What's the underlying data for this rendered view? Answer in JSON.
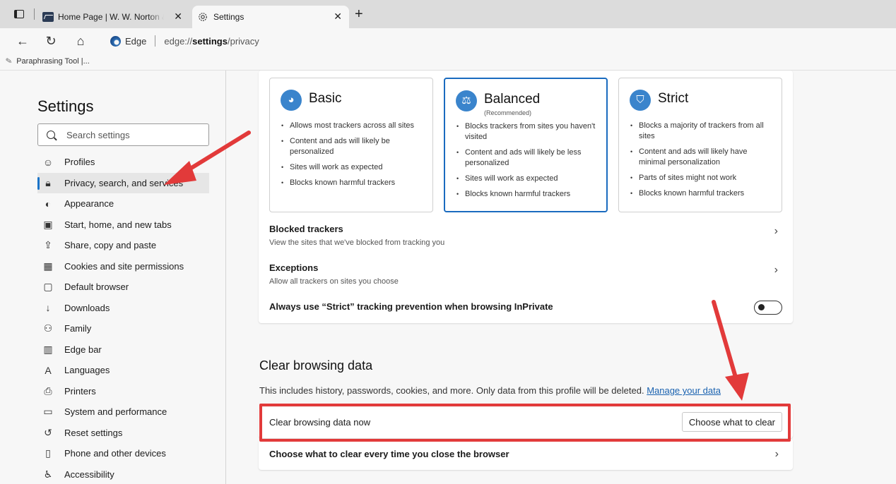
{
  "tabs": [
    {
      "title": "Home Page | W. W. Norton & Co",
      "active": false
    },
    {
      "title": "Settings",
      "active": true
    }
  ],
  "toolbar": {
    "address_label": "Edge",
    "address_url_prefix": "edge://",
    "address_url_host": "settings",
    "address_url_path": "/privacy"
  },
  "favorites": [
    {
      "label": "Paraphrasing Tool |..."
    }
  ],
  "sidebar": {
    "title": "Settings",
    "search_placeholder": "Search settings",
    "items": [
      {
        "label": "Profiles",
        "icon": "profile-icon",
        "active": false
      },
      {
        "label": "Privacy, search, and services",
        "icon": "lock-icon",
        "active": true
      },
      {
        "label": "Appearance",
        "icon": "palette-icon",
        "active": false
      },
      {
        "label": "Start, home, and new tabs",
        "icon": "home-tabs-icon",
        "active": false
      },
      {
        "label": "Share, copy and paste",
        "icon": "share-icon",
        "active": false
      },
      {
        "label": "Cookies and site permissions",
        "icon": "cookies-icon",
        "active": false
      },
      {
        "label": "Default browser",
        "icon": "browser-icon",
        "active": false
      },
      {
        "label": "Downloads",
        "icon": "download-icon",
        "active": false
      },
      {
        "label": "Family",
        "icon": "family-icon",
        "active": false
      },
      {
        "label": "Edge bar",
        "icon": "edge-bar-icon",
        "active": false
      },
      {
        "label": "Languages",
        "icon": "languages-icon",
        "active": false
      },
      {
        "label": "Printers",
        "icon": "printer-icon",
        "active": false
      },
      {
        "label": "System and performance",
        "icon": "laptop-icon",
        "active": false
      },
      {
        "label": "Reset settings",
        "icon": "reset-icon",
        "active": false
      },
      {
        "label": "Phone and other devices",
        "icon": "phone-icon",
        "active": false
      },
      {
        "label": "Accessibility",
        "icon": "accessibility-icon",
        "active": false
      }
    ]
  },
  "tracking": {
    "levels": [
      {
        "name": "Basic",
        "sub": "",
        "icon": "basic-icon",
        "selected": false,
        "bullets": [
          "Allows most trackers across all sites",
          "Content and ads will likely be personalized",
          "Sites will work as expected",
          "Blocks known harmful trackers"
        ]
      },
      {
        "name": "Balanced",
        "sub": "(Recommended)",
        "icon": "scale-icon",
        "selected": true,
        "bullets": [
          "Blocks trackers from sites you haven't visited",
          "Content and ads will likely be less personalized",
          "Sites will work as expected",
          "Blocks known harmful trackers"
        ]
      },
      {
        "name": "Strict",
        "sub": "",
        "icon": "shield-icon",
        "selected": false,
        "bullets": [
          "Blocks a majority of trackers from all sites",
          "Content and ads will likely have minimal personalization",
          "Parts of sites might not work",
          "Blocks known harmful trackers"
        ]
      }
    ],
    "blocked_title": "Blocked trackers",
    "blocked_desc": "View the sites that we've blocked from tracking you",
    "exceptions_title": "Exceptions",
    "exceptions_desc": "Allow all trackers on sites you choose",
    "inprivate_label": "Always use “Strict” tracking prevention when browsing InPrivate",
    "inprivate_on": false
  },
  "clear_data": {
    "title": "Clear browsing data",
    "desc": "This includes history, passwords, cookies, and more. Only data from this profile will be deleted.",
    "manage_link": "Manage your data",
    "now_label": "Clear browsing data now",
    "choose_button": "Choose what to clear",
    "every_time_label": "Choose what to clear every time you close the browser"
  },
  "annotation_color": "#e23a3a",
  "accent_color": "#1a6bbf"
}
